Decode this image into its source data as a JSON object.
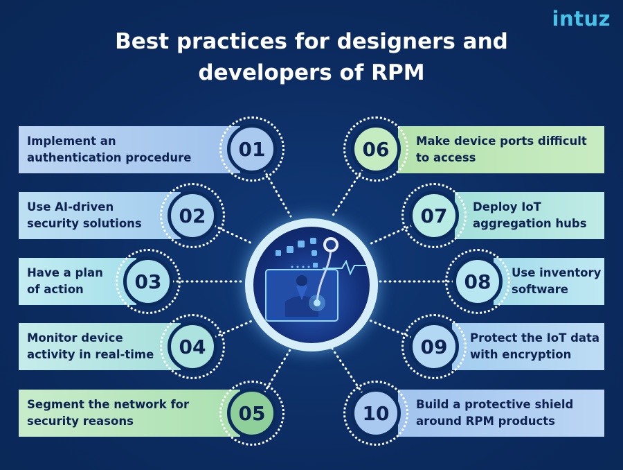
{
  "brand": {
    "logo": "intuz"
  },
  "title": {
    "line1": "Best practices for designers and",
    "line2": "developers of RPM"
  },
  "colors": {
    "background": "#0b2a5e",
    "blue_light": "#a9c9ee",
    "cyan_light": "#aee0ec",
    "green_light": "#b9e4b2",
    "center_ring": "#d6eef8"
  },
  "practices": [
    {
      "number": "01",
      "line1": "Implement an",
      "line2": "authentication procedure"
    },
    {
      "number": "02",
      "line1": "Use AI-driven",
      "line2": "security solutions"
    },
    {
      "number": "03",
      "line1": "Have a plan",
      "line2": "of action"
    },
    {
      "number": "04",
      "line1": "Monitor device",
      "line2": "activity in real-time"
    },
    {
      "number": "05",
      "line1": "Segment the network for",
      "line2": "security reasons"
    },
    {
      "number": "06",
      "line1": "Make device ports difficult",
      "line2": "to access"
    },
    {
      "number": "07",
      "line1": "Deploy IoT",
      "line2": "aggregation hubs"
    },
    {
      "number": "08",
      "line1": "Use inventory",
      "line2": "software"
    },
    {
      "number": "09",
      "line1": "Protect the IoT data",
      "line2": "with encryption"
    },
    {
      "number": "10",
      "line1": "Build a protective shield",
      "line2": "around RPM products"
    }
  ],
  "center_illustration": "doctor-with-stethoscope-on-monitor"
}
